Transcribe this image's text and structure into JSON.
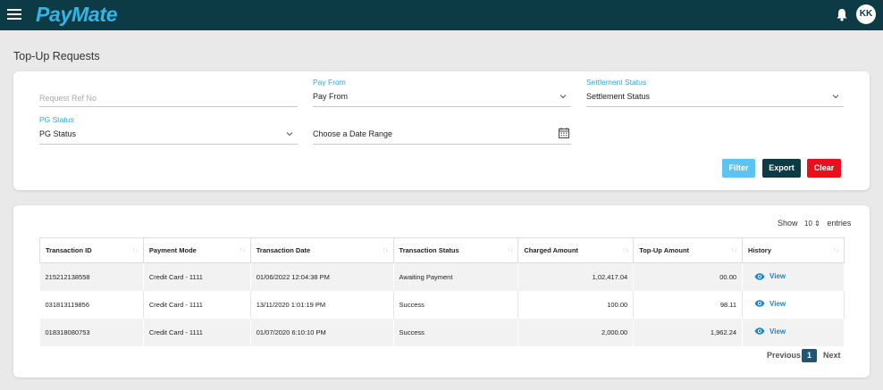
{
  "app": {
    "brand": "PayMate",
    "user_initials": "KK"
  },
  "page": {
    "title": "Top-Up Requests"
  },
  "filters": {
    "request_ref_placeholder": "Request Ref No",
    "pay_from": {
      "label": "Pay From",
      "value": "Pay From"
    },
    "settlement_status": {
      "label": "Settlement Status",
      "value": "Settlement Status"
    },
    "pg_status": {
      "label": "PG Status",
      "value": "PG Status"
    },
    "date_range": {
      "value": "Choose a Date Range"
    },
    "filter_button": "Filter",
    "export_button": "Export",
    "clear_button": "Clear"
  },
  "colors": {
    "topbar": "#0d3b45",
    "brand": "#34b5e6",
    "filter": "#5bc4f1",
    "export": "#0d3b45",
    "clear": "#e8101c",
    "accent_label": "#29a8e0"
  },
  "table": {
    "show_label": "Show",
    "entries_value": "10",
    "entries_label": "entries",
    "columns": [
      "Transaction ID",
      "Payment Mode",
      "Transaction Date",
      "Transaction Status",
      "Charged Amount",
      "Top-Up Amount",
      "History"
    ],
    "rows": [
      {
        "id": "215212138558",
        "mode": "Credit Card - 1111",
        "date": "01/06/2022 12:04:38 PM",
        "status": "Awaiting Payment",
        "charged": "1,02,417.04",
        "topup": "00.00",
        "history": "View"
      },
      {
        "id": "031813119856",
        "mode": "Credit Card - 1111",
        "date": "13/11/2020 1:01:19 PM",
        "status": "Success",
        "charged": "100.00",
        "topup": "98.11",
        "history": "View"
      },
      {
        "id": "018318080753",
        "mode": "Credit Card - 1111",
        "date": "01/07/2020 6:10:10 PM",
        "status": "Success",
        "charged": "2,000.00",
        "topup": "1,962.24",
        "history": "View"
      }
    ],
    "pagination": {
      "previous": "Previous",
      "current": "1",
      "next": "Next"
    }
  }
}
